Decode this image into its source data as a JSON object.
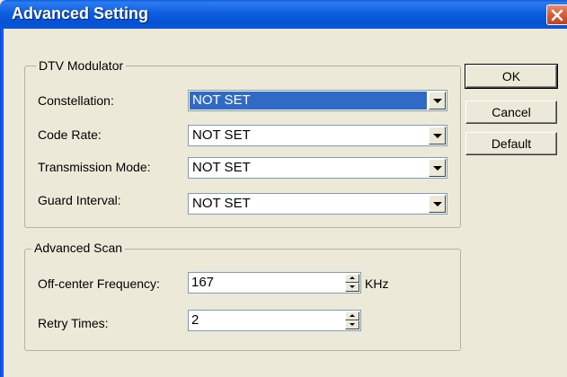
{
  "window": {
    "title": "Advanced Setting"
  },
  "dtv_modulator": {
    "legend": "DTV Modulator",
    "fields": [
      {
        "label": "Constellation:",
        "value": "NOT SET",
        "selected": true
      },
      {
        "label": "Code Rate:",
        "value": "NOT SET",
        "selected": false
      },
      {
        "label": "Transmission Mode:",
        "value": "NOT SET",
        "selected": false
      },
      {
        "label": "Guard Interval:",
        "value": "NOT SET",
        "selected": false
      }
    ]
  },
  "advanced_scan": {
    "legend": "Advanced Scan",
    "offcenter": {
      "label": "Off-center Frequency:",
      "value": "167",
      "unit": "KHz"
    },
    "retry": {
      "label": "Retry Times:",
      "value": "2"
    }
  },
  "buttons": {
    "ok": "OK",
    "cancel": "Cancel",
    "default": "Default"
  },
  "icons": {
    "close": "close-icon",
    "dropdown": "chevron-down-icon",
    "spin_up": "spin-up-icon",
    "spin_down": "spin-down-icon"
  },
  "colors": {
    "titlebar": "#0552d4",
    "close": "#d85a36",
    "selection": "#316ac5",
    "dialog_bg": "#ece9d8"
  }
}
